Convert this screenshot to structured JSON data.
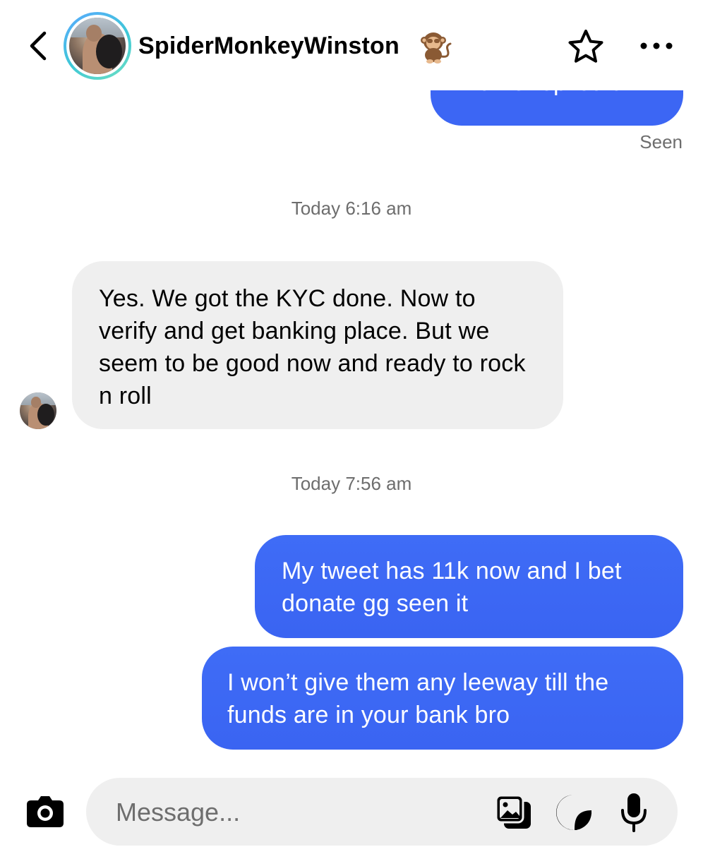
{
  "header": {
    "username": "SpiderMonkeyWinston",
    "username_emoji": "monkey-emoji",
    "icons": {
      "back": "chevron-left-icon",
      "favorite": "star-icon",
      "more": "more-horizontal-icon"
    }
  },
  "conversation": {
    "previous_message": "Did he replied u?",
    "seen_label": "Seen",
    "groups": [
      {
        "timestamp": "Today 6:16 am",
        "messages": [
          {
            "direction": "incoming",
            "text": "Yes. We got the KYC done. Now to verify and get banking place. But we seem to be good now and ready to rock n roll"
          }
        ]
      },
      {
        "timestamp": "Today 7:56 am",
        "messages": [
          {
            "direction": "outgoing",
            "text": "My tweet has 11k now and I bet donate gg seen it"
          },
          {
            "direction": "outgoing",
            "text": "I won’t give them any leeway till the funds are in your bank bro"
          }
        ]
      }
    ]
  },
  "composer": {
    "placeholder": "Message...",
    "icons": {
      "camera": "camera-icon",
      "gallery": "gallery-icon",
      "sticker": "sticker-icon",
      "mic": "microphone-icon"
    }
  },
  "colors": {
    "outgoing_bubble": "#3c66f4",
    "incoming_bubble": "#efefef",
    "secondary_text": "#6d6d6d",
    "story_ring_start": "#5aa9ff",
    "story_ring_end": "#6fe0c2"
  }
}
